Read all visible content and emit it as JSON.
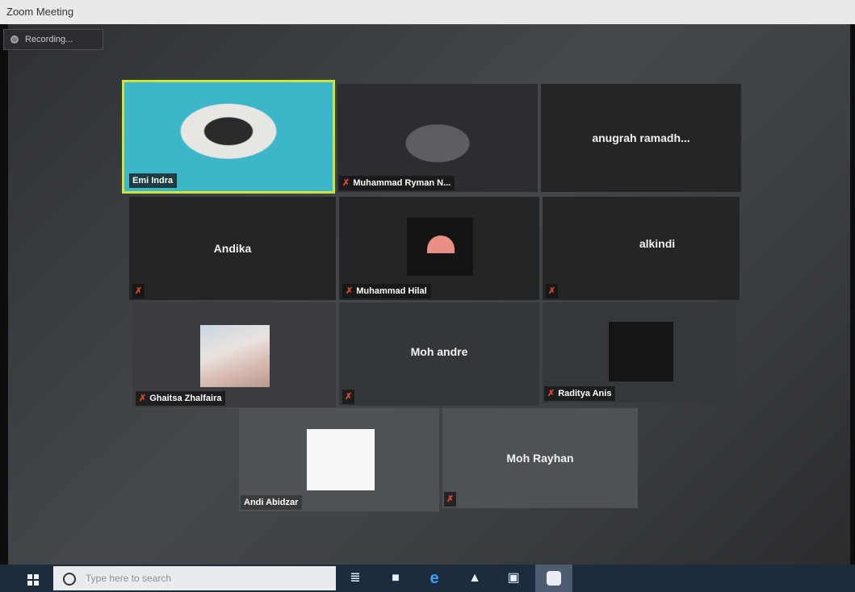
{
  "window": {
    "title": "Zoom Meeting"
  },
  "recording": {
    "label": "Recording..."
  },
  "participants": [
    {
      "name": "Emi Indra",
      "muted": false,
      "active_speaker": true
    },
    {
      "name": "Muhammad Ryman N...",
      "muted": true
    },
    {
      "name": "anugrah ramadh...",
      "center_label": true
    },
    {
      "name": "Andika",
      "center_label": true,
      "muted": true
    },
    {
      "name": "Muhammad Hilal",
      "muted": true
    },
    {
      "name": "alkindi",
      "center_label": true,
      "muted": true
    },
    {
      "name": "Ghaitsa Zhalfaira",
      "muted": true
    },
    {
      "name": "Moh andre",
      "center_label": true,
      "muted": true
    },
    {
      "name": "Raditya Anis",
      "muted": true
    },
    {
      "name": "Andi Abidzar",
      "muted": false
    },
    {
      "name": "Moh Rayhan",
      "center_label": true,
      "muted": true
    }
  ],
  "taskbar": {
    "search_placeholder": "Type here to search",
    "icons": [
      "windows-start-icon",
      "task-view-icon",
      "file-explorer-icon",
      "edge-icon",
      "mail-icon",
      "store-icon",
      "zoom-icon"
    ]
  },
  "colors": {
    "active_speaker_border": "#c9e43a",
    "mic_muted": "#e0462a",
    "taskbar": "#1c2b3d"
  }
}
